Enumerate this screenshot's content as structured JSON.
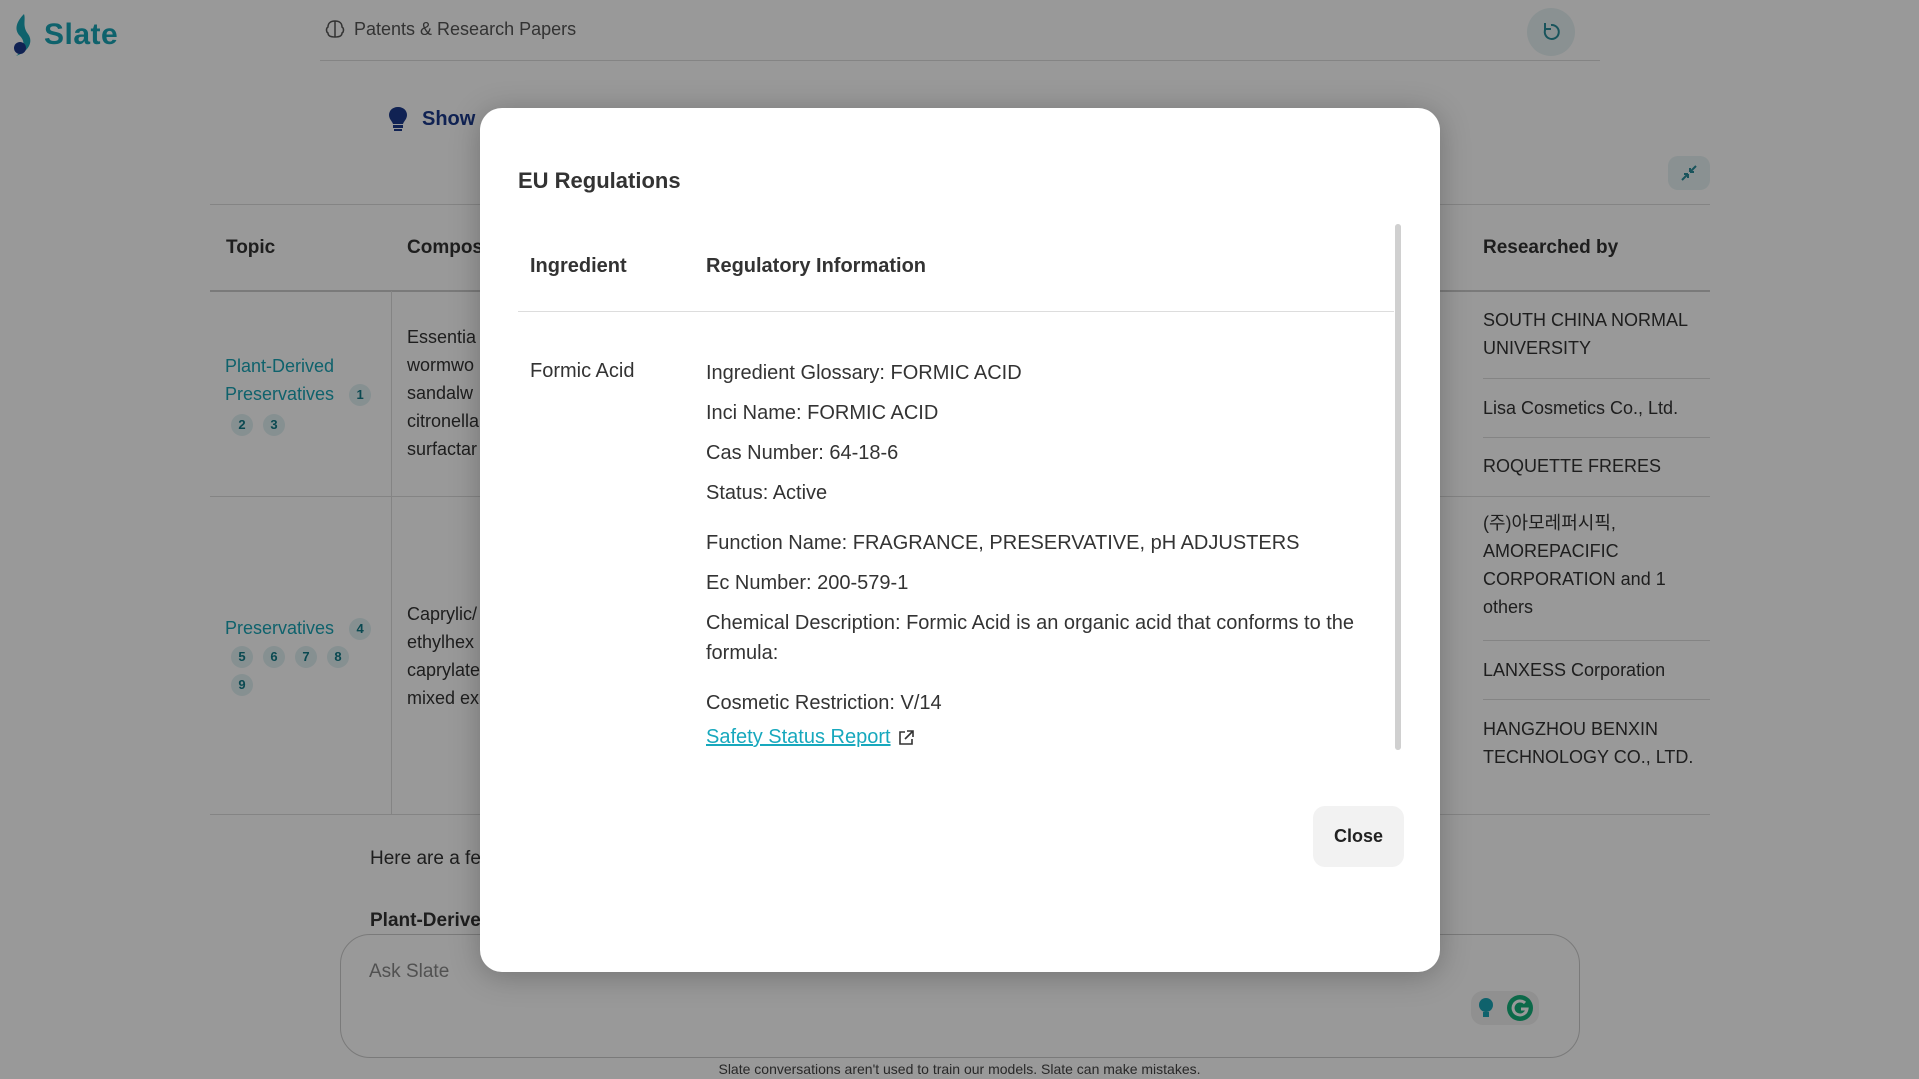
{
  "app": {
    "logo_text": "Slate",
    "breadcrumb": "Patents & Research Papers",
    "show_label": "Show"
  },
  "table": {
    "headers": {
      "topic": "Topic",
      "composition": "Compos",
      "researched_by": "Researched by"
    },
    "rows": [
      {
        "topic_line1": "Plant-Derived",
        "topic_line2": "Preservatives",
        "badges_a": [
          "1"
        ],
        "badges_b": [
          "2",
          "3"
        ],
        "composition": [
          "Essentia",
          "wormwo",
          "sandalw",
          "citronella",
          "surfactar"
        ]
      },
      {
        "topic_line1": "Preservatives",
        "badges_a": [
          "4"
        ],
        "badges_b": [
          "5",
          "6",
          "7",
          "8"
        ],
        "badges_c": [
          "9"
        ],
        "composition": [
          "Caprylic/",
          "ethylhex",
          "caprylate",
          "mixed ex"
        ]
      }
    ],
    "researchers": [
      "SOUTH CHINA NORMAL UNIVERSITY",
      "Lisa Cosmetics Co., Ltd.",
      "ROQUETTE FRERES",
      "(주)아모레퍼시픽, AMOREPACIFIC CORPORATION and 1 others",
      "LANXESS Corporation",
      "HANGZHOU BENXIN TECHNOLOGY CO., LTD."
    ]
  },
  "below": {
    "text": "Here are a fe",
    "bold": "Plant-Derive"
  },
  "ask": {
    "placeholder": "Ask Slate",
    "disclaimer": "Slate conversations aren't used to train our models. Slate can make mistakes."
  },
  "modal": {
    "title": "EU Regulations",
    "col_ingredient": "Ingredient",
    "col_info": "Regulatory Information",
    "ingredient": "Formic Acid",
    "info": {
      "glossary": "Ingredient Glossary: FORMIC ACID",
      "inci": "Inci Name: FORMIC ACID",
      "cas": "Cas Number: 64-18-6",
      "status": "Status: Active",
      "function": "Function Name: FRAGRANCE, PRESERVATIVE, pH ADJUSTERS",
      "ec": "Ec Number: 200-579-1",
      "chemical": "Chemical Description: Formic Acid is an organic acid that conforms to the formula:",
      "restriction": "Cosmetic Restriction: V/14"
    },
    "link_label": "Safety Status Report",
    "close_label": "Close"
  },
  "colors": {
    "brand": "#1aa3b5",
    "link": "#17a8bd",
    "show": "#1b3a8a"
  },
  "icons": [
    "logo-icon",
    "brain-icon",
    "refresh-icon",
    "lightbulb-icon",
    "collapse-icon",
    "external-link-icon",
    "grammarly-icon"
  ]
}
